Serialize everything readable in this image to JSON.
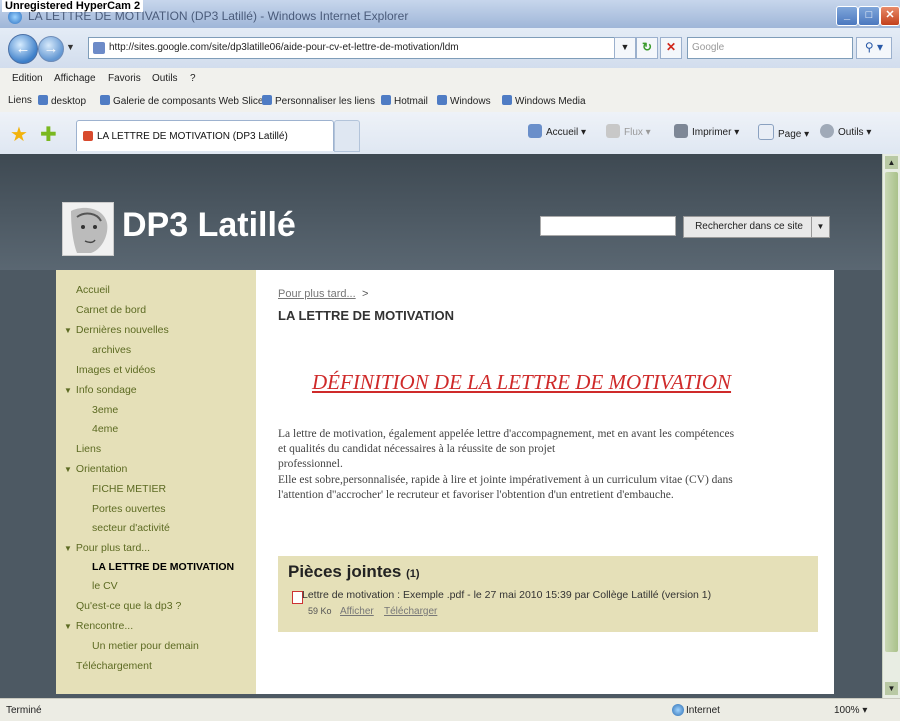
{
  "recorder_watermark": "Unregistered HyperCam 2",
  "window": {
    "title": "LA LETTRE DE MOTIVATION (DP3 Latillé) - Windows Internet Explorer",
    "minimize": "_",
    "maximize": "□",
    "close": "✕"
  },
  "address_bar": {
    "url": "http://sites.google.com/site/dp3latille06/aide-pour-cv-et-lettre-de-motivation/ldm"
  },
  "search_bar": {
    "placeholder": "Google"
  },
  "menu": [
    "Edition",
    "Affichage",
    "Favoris",
    "Outils",
    "?"
  ],
  "links_bar": {
    "label": "Liens",
    "items": [
      "desktop",
      "Galerie de composants Web Slice",
      "Personnaliser les liens",
      "Hotmail",
      "Windows",
      "Windows Media"
    ]
  },
  "tab": {
    "label": "LA LETTRE DE MOTIVATION (DP3 Latillé)"
  },
  "command_bar": {
    "home": "Accueil",
    "feeds": "Flux",
    "print": "Imprimer",
    "page": "Page",
    "tools": "Outils"
  },
  "site": {
    "title": "DP3 Latillé",
    "search_button": "Rechercher dans ce site",
    "sidebar": [
      {
        "label": "Accueil",
        "level": 0,
        "expand": false
      },
      {
        "label": "Carnet de bord",
        "level": 0,
        "expand": false
      },
      {
        "label": "Dernières nouvelles",
        "level": 0,
        "expand": true
      },
      {
        "label": "archives",
        "level": 1,
        "expand": false
      },
      {
        "label": "Images et vidéos",
        "level": 0,
        "expand": false
      },
      {
        "label": "Info sondage",
        "level": 0,
        "expand": true
      },
      {
        "label": "3eme",
        "level": 1,
        "expand": false
      },
      {
        "label": "4eme",
        "level": 1,
        "expand": false
      },
      {
        "label": "Liens",
        "level": 0,
        "expand": false
      },
      {
        "label": "Orientation",
        "level": 0,
        "expand": true
      },
      {
        "label": "FICHE METIER",
        "level": 1,
        "expand": false
      },
      {
        "label": "Portes ouvertes",
        "level": 1,
        "expand": false
      },
      {
        "label": "secteur d'activité",
        "level": 1,
        "expand": false
      },
      {
        "label": "Pour plus tard...",
        "level": 0,
        "expand": true
      },
      {
        "label": "LA LETTRE DE MOTIVATION",
        "level": 1,
        "expand": false,
        "active": true
      },
      {
        "label": "le CV",
        "level": 1,
        "expand": false
      },
      {
        "label": "Qu'est-ce que la dp3 ?",
        "level": 0,
        "expand": false
      },
      {
        "label": "Rencontre...",
        "level": 0,
        "expand": true
      },
      {
        "label": "Un metier pour demain",
        "level": 1,
        "expand": false
      },
      {
        "label": "Téléchargement",
        "level": 0,
        "expand": false
      }
    ],
    "breadcrumb": {
      "link": "Pour plus tard...",
      "separator": ">"
    },
    "page_title": "LA LETTRE DE MOTIVATION",
    "heading": "DÉFINITION DE LA LETTRE DE MOTIVATION",
    "paragraph_lines": [
      "La lettre de motivation, également appelée lettre d'accompagnement, met en avant les compétences",
      "et qualités du candidat nécessaires à la réussite de son projet",
      "professionnel.",
      "Elle est sobre,personnalisée, rapide à lire et jointe impérativement à un curriculum vitae (CV) dans",
      "l'attention d''accrocher' le recruteur et favoriser l'obtention d'un entretient d'embauche."
    ],
    "attachments": {
      "title": "Pièces jointes",
      "count": "(1)",
      "file": "Lettre de motivation : Exemple .pdf - le 27 mai 2010 15:39 par Collège Latillé (version 1)",
      "size": "59 Ko",
      "view": "Afficher",
      "download": "Télécharger"
    }
  },
  "status_bar": {
    "text": "Terminé",
    "zone": "Internet",
    "zoom": "100%"
  }
}
